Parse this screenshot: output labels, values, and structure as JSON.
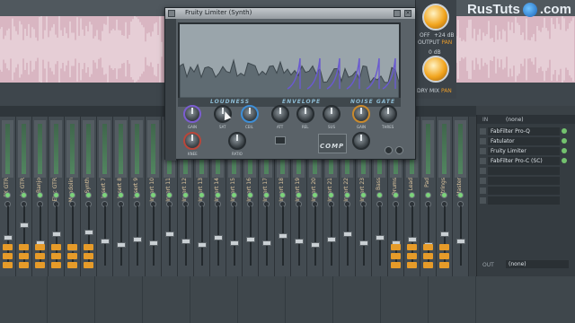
{
  "watermark": {
    "text": "RusTuts",
    "suffix": ".com"
  },
  "plugin": {
    "title": "Fruity Limiter (Synth)",
    "tabs": [
      "LOUDNESS",
      "ENVELOPE",
      "NOISE GATE"
    ],
    "comp_label": "COMP",
    "close_glyph": "×",
    "knob_labels": [
      "GAIN",
      "SAT",
      "CEIL",
      "ATT",
      "REL",
      "SUS",
      "GAIN",
      "THRES",
      "KNEE",
      "RATIO"
    ]
  },
  "side": {
    "output_label": "OUTPUT",
    "drymix_label": "DRY MIX",
    "pan_label": "PAN",
    "off_label": "OFF",
    "db_label": "+24 dB",
    "db0": "0 dB"
  },
  "mixer": {
    "strips": [
      "FX GTR",
      "Ac GTR",
      "Banjo",
      "Elec GTR",
      "Mandolin",
      "Synth",
      "Insert 7",
      "Insert 8",
      "Insert 9",
      "Insert 10",
      "Insert 11",
      "Insert 12",
      "Insert 13",
      "Insert 14",
      "Insert 15",
      "Insert 16",
      "Insert 17",
      "Insert 18",
      "Insert 19",
      "Insert 20",
      "Insert 21",
      "Insert 22",
      "Insert 23",
      "Bass",
      "Drums",
      "Lead",
      "Pad",
      "Strings",
      "Master"
    ]
  },
  "fx": {
    "in_label": "IN",
    "out_label": "OUT",
    "none": "(none)",
    "slots": [
      "FabFilter Pro-Q",
      "Fatulator",
      "Fruity Limiter",
      "FabFilter Pro-C (SC)",
      "",
      "",
      "",
      ""
    ]
  },
  "colors": {
    "accent": "#e69b29",
    "meter": "#4fa85d"
  }
}
